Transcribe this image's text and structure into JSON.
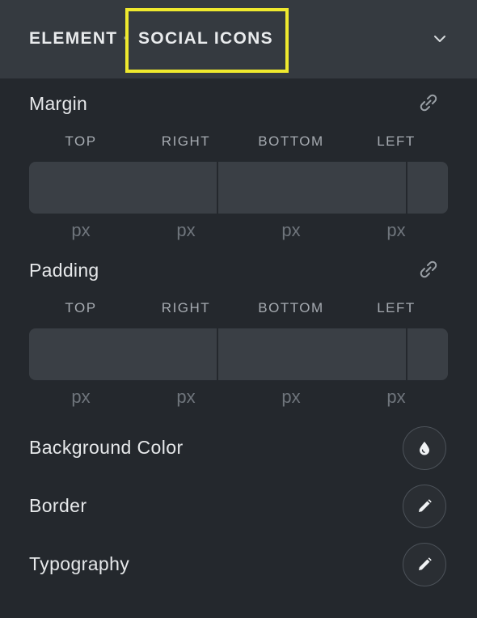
{
  "header": {
    "crumb_parent": "ELEMENT",
    "crumb_separator": "·",
    "crumb_current": "SOCIAL ICONS",
    "highlight_color": "#efe92e"
  },
  "margin": {
    "title": "Margin",
    "sides": [
      "TOP",
      "RIGHT",
      "BOTTOM",
      "LEFT"
    ],
    "values": [
      "",
      "",
      "",
      ""
    ],
    "unit": "px"
  },
  "padding": {
    "title": "Padding",
    "sides": [
      "TOP",
      "RIGHT",
      "BOTTOM",
      "LEFT"
    ],
    "values": [
      "",
      "",
      "",
      ""
    ],
    "unit": "px"
  },
  "properties": {
    "background_color": "Background Color",
    "border": "Border",
    "typography": "Typography"
  },
  "icons": {
    "collapse": "chevron-down-icon",
    "link": "link-icon",
    "color": "droplet-icon",
    "edit": "pencil-icon"
  },
  "colors": {
    "panel_bg": "#24282d",
    "header_bg": "#353a40",
    "input_bg": "#3a3f45"
  }
}
